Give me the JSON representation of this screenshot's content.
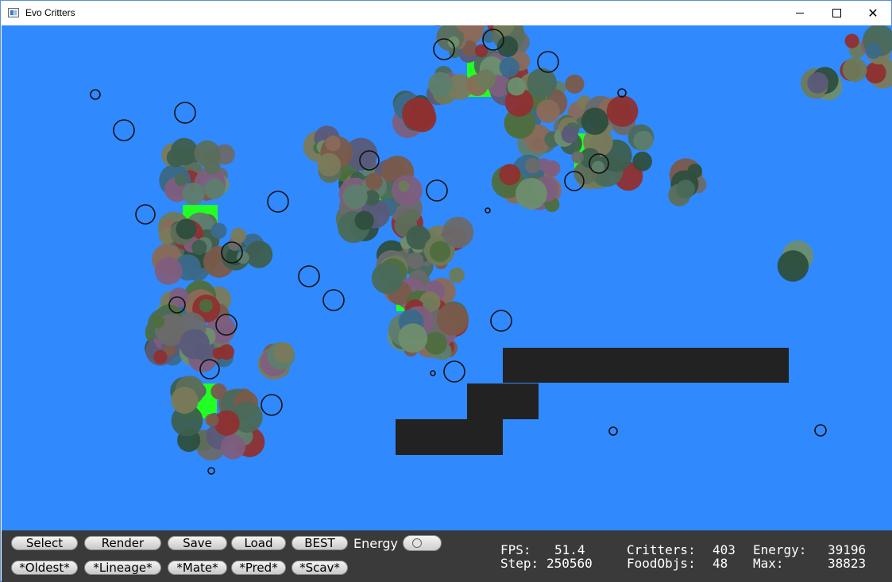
{
  "window": {
    "title": "Evo Critters",
    "icons": {
      "app": "app-window-icon",
      "minimize": "minimize-icon",
      "maximize": "maximize-icon",
      "close": "close-icon"
    }
  },
  "world": {
    "background": "#3189fe",
    "obstacle_color": "#222222",
    "food_color": "#22ff22"
  },
  "controls": {
    "row1": [
      "Select",
      "Render",
      "Save",
      "Load",
      "BEST"
    ],
    "row2": [
      "*Oldest*",
      "*Lineage*",
      "*Mate*",
      "*Pred*",
      "*Scav*"
    ],
    "energy_label": "Energy"
  },
  "stats": {
    "fps_label": "FPS:",
    "fps": "51.4",
    "step_label": "Step:",
    "step": "250560",
    "critters_label": "Critters:",
    "critters": "403",
    "foodobjs_label": "FoodObjs:",
    "foodobjs": "48",
    "energy_label": "Energy:",
    "energy": "39196",
    "max_label": "Max:",
    "max": "38823"
  }
}
